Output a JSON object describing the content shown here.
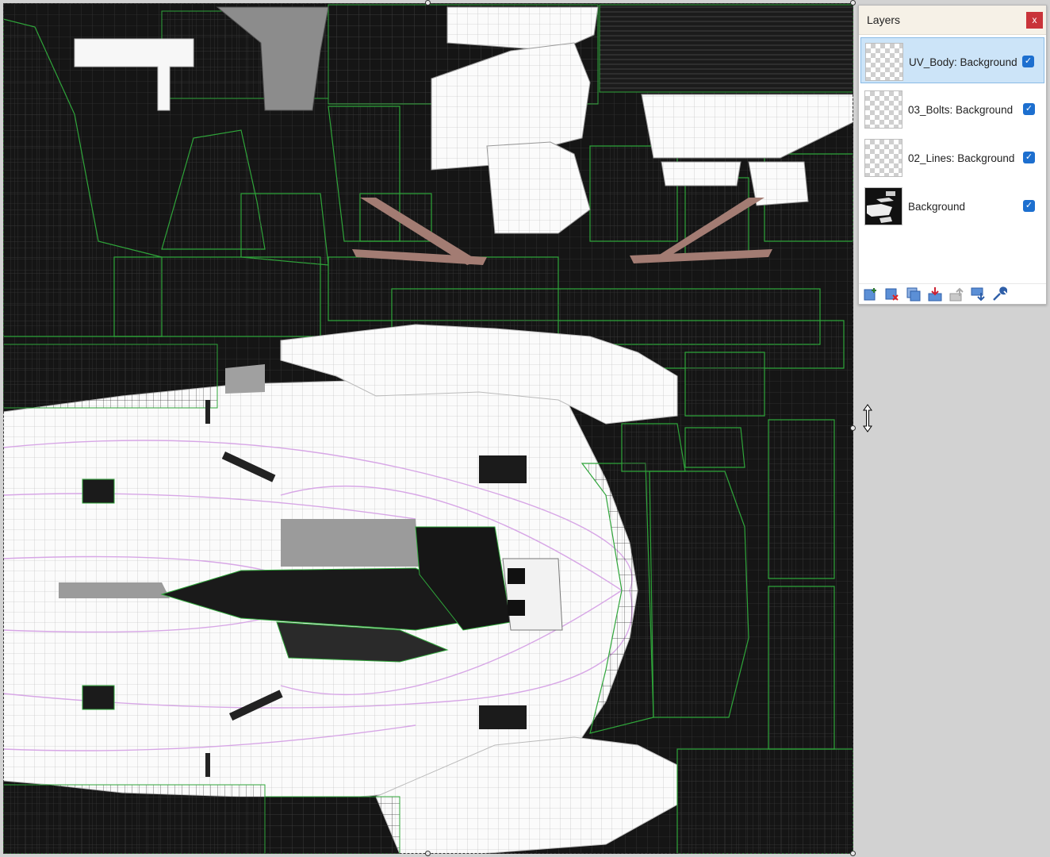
{
  "panel": {
    "title": "Layers",
    "close_label": "x"
  },
  "layers": [
    {
      "name": "UV_Body: Background",
      "visible": true,
      "selected": true
    },
    {
      "name": "03_Bolts: Background",
      "visible": true,
      "selected": false
    },
    {
      "name": "02_Lines: Background",
      "visible": true,
      "selected": false
    },
    {
      "name": "Background",
      "visible": true,
      "selected": false
    }
  ],
  "toolbar": {
    "icons": [
      "add-layer-icon",
      "delete-layer-icon",
      "duplicate-layer-icon",
      "merge-layer-down-icon",
      "move-layer-up-icon",
      "move-layer-down-icon",
      "layer-properties-icon"
    ]
  },
  "colors": {
    "uv_dark": "#151515",
    "uv_panel_white": "#ffffff",
    "uv_wire_green": "#2fa53a",
    "uv_wire_pink": "#d7a6e6",
    "selected_row": "#cce4f8",
    "checkbox": "#1d6fcf",
    "close_button": "#c9343a"
  }
}
